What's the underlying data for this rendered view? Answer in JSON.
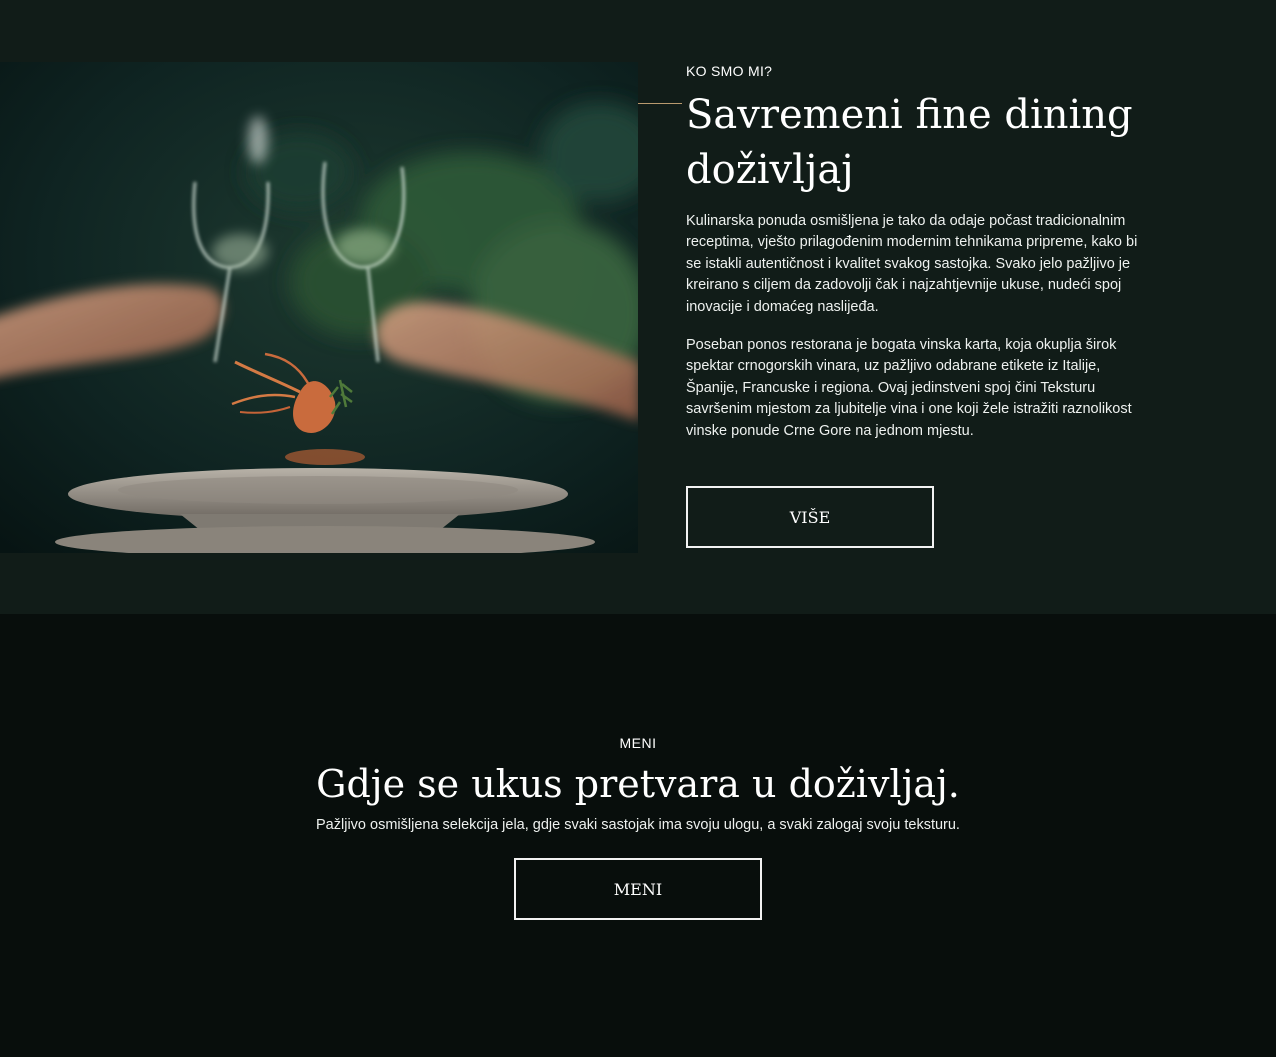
{
  "about": {
    "eyebrow": "KO SMO MI?",
    "title": "Savremeni fine dining doživljaj",
    "paragraph_1": "Kulinarska ponuda osmišljena je tako da odaje počast tradicionalnim receptima, vješto prilagođenim modernim tehnikama pripreme, kako bi se istakli autentičnost i kvalitet svakog sastojka. Svako jelo pažljivo je kreirano s ciljem da zadovolji čak i najzahtjevnije ukuse, nudeći spoj inovacije i domaćeg naslijeđa.",
    "paragraph_2": "Poseban ponos restorana je bogata vinska karta, koja okuplja širok spektar crnogorskih vinara, uz pažljivo odabrane etikete iz Italije, Španije, Francuske i regiona. Ovaj jedinstveni spoj čini Teksturu savršenim mjestom za ljubitelje vina i one koji žele istražiti raznolikost vinske ponude Crne Gore na jednom mjestu.",
    "button_label": "VIŠE"
  },
  "menu": {
    "eyebrow": "MENI",
    "title": "Gdje se ukus pretvara u doživljaj.",
    "subtitle": "Pažljivo osmišljena selekcija jela, gdje svaki sastojak ima svoju ulogu, a svaki zalogaj svoju teksturu.",
    "button_label": "MENI"
  },
  "colors": {
    "about_background": "#111c18",
    "menu_background": "#080e0c",
    "accent_line": "#b99a6e",
    "text": "#ffffff",
    "button_border": "#f2f2f2"
  }
}
